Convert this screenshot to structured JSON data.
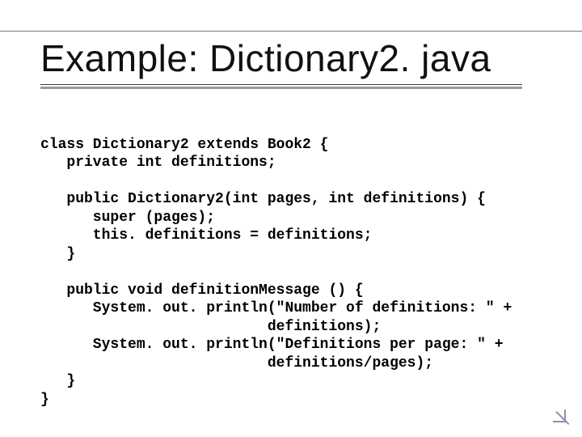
{
  "title": "Example: Dictionary2. java",
  "code": {
    "l01": "class Dictionary2 extends Book2 {",
    "l02": "   private int definitions;",
    "l03": "",
    "l04": "   public Dictionary2(int pages, int definitions) {",
    "l05": "      super (pages);",
    "l06": "      this. definitions = definitions;",
    "l07": "   }",
    "l08": "",
    "l09": "   public void definitionMessage () {",
    "l10": "      System. out. println(\"Number of definitions: \" +",
    "l11": "                          definitions);",
    "l12": "      System. out. println(\"Definitions per page: \" +",
    "l13": "                          definitions/pages);",
    "l14": "   }",
    "l15": "}"
  }
}
